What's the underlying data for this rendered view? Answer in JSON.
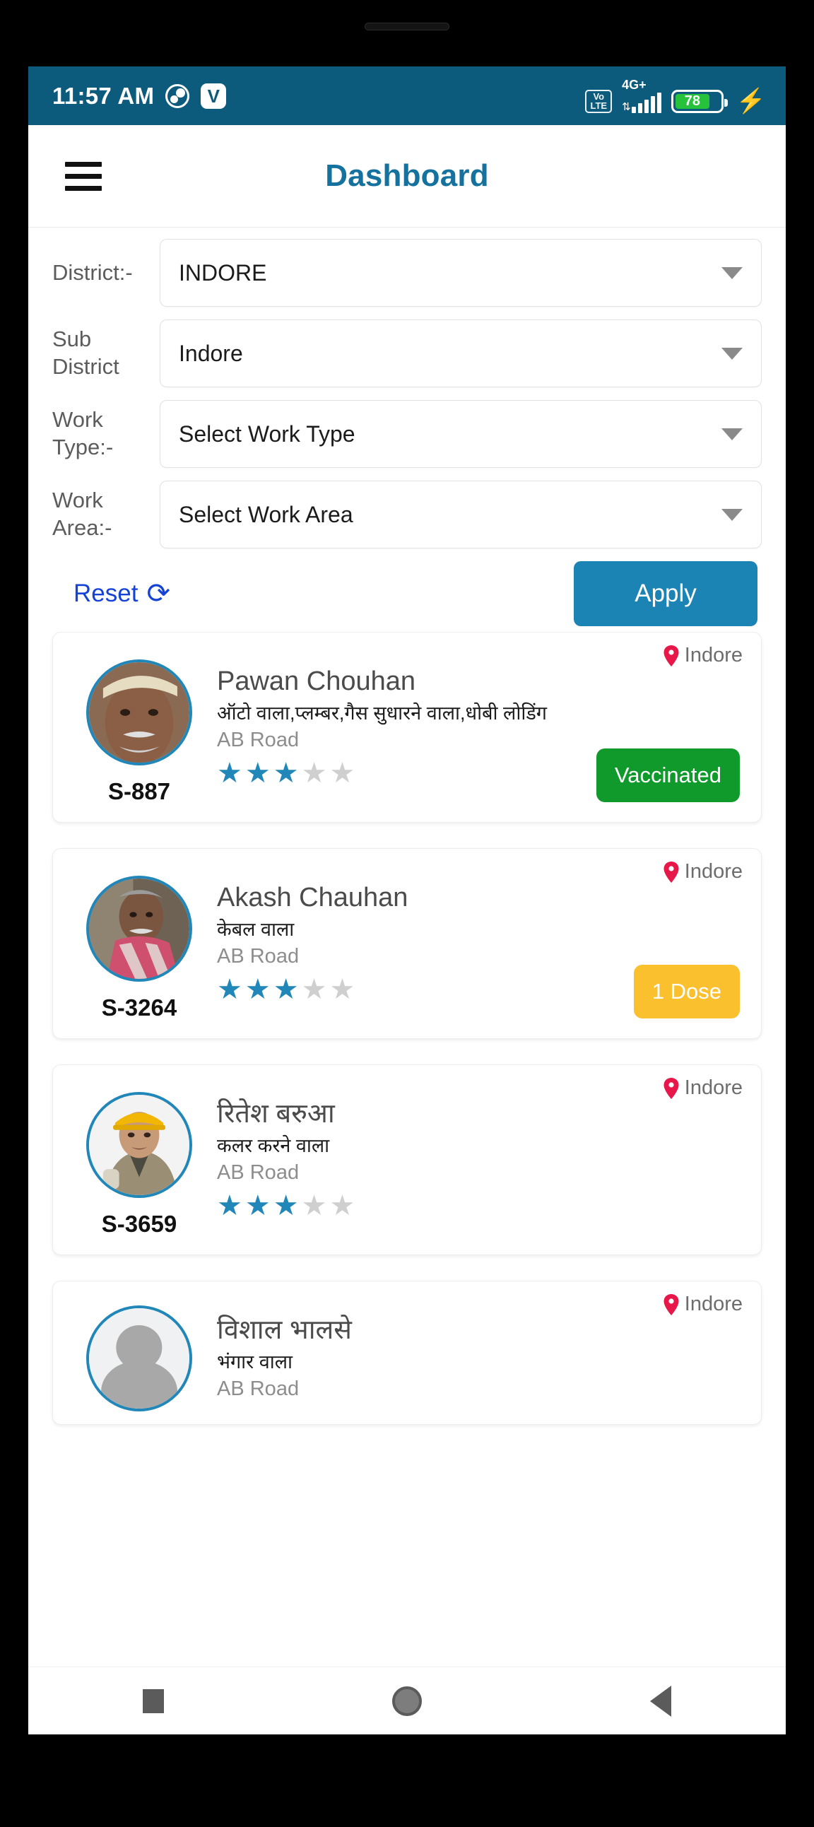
{
  "statusbar": {
    "time": "11:57 AM",
    "clock_app_icon": "clock-app-icon",
    "v_app_icon": "V",
    "volte_line1": "Vo",
    "volte_line2": "LTE",
    "network": "4G+",
    "data_arrows": "⇅",
    "battery_level": "78",
    "charging_icon": "⚡",
    "bar_color": "#0c5b7d",
    "battery_fill_color": "#27c23c"
  },
  "appbar": {
    "menu_icon": "hamburger-menu-icon",
    "title": "Dashboard",
    "title_color": "#15719e"
  },
  "filters": {
    "rows": [
      {
        "label": "District:-",
        "value": "INDORE"
      },
      {
        "label": "Sub District",
        "value": "Indore"
      },
      {
        "label": "Work Type:-",
        "value": "Select Work Type"
      },
      {
        "label": "Work Area:-",
        "value": "Select Work Area"
      }
    ],
    "reset_label": "Reset",
    "reset_icon": "refresh-icon",
    "reset_color": "#1443d6",
    "apply_label": "Apply",
    "apply_color": "#1c83b5"
  },
  "workers": [
    {
      "id": "S-887",
      "name": "Pawan Chouhan",
      "work_type": "ऑटो वाला,प्लम्बर,गैस  सुधारने वाला,धोबी लोडिंग",
      "address": "AB Road",
      "location": "Indore",
      "rating": 3,
      "rating_max": 5,
      "badge": "Vaccinated",
      "badge_color": "#109a2c",
      "avatar": "photo-elderly-man-white-cap"
    },
    {
      "id": "S-3264",
      "name": "Akash Chauhan",
      "work_type": "केबल वाला",
      "address": "AB Road",
      "location": "Indore",
      "rating": 3,
      "rating_max": 5,
      "badge": "1 Dose",
      "badge_color": "#fbc02d",
      "avatar": "photo-man-red-scarf"
    },
    {
      "id": "S-3659",
      "name": "रितेश बरुआ",
      "work_type": "कलर करने वाला",
      "address": "AB Road",
      "location": "Indore",
      "rating": 3,
      "rating_max": 5,
      "badge": "",
      "badge_color": "",
      "avatar": "photo-worker-yellow-helmet"
    },
    {
      "id": "",
      "name": "विशाल भालसे",
      "work_type": "भंगार वाला",
      "address": "AB Road",
      "location": "Indore",
      "rating": 0,
      "rating_max": 5,
      "badge": "",
      "badge_color": "",
      "avatar": "placeholder-person-icon"
    }
  ],
  "navbar": {
    "recents_icon": "square-recents-icon",
    "home_icon": "circle-home-icon",
    "back_icon": "triangle-back-icon"
  },
  "glyphs": {
    "star": "★",
    "refresh": "⟳"
  }
}
